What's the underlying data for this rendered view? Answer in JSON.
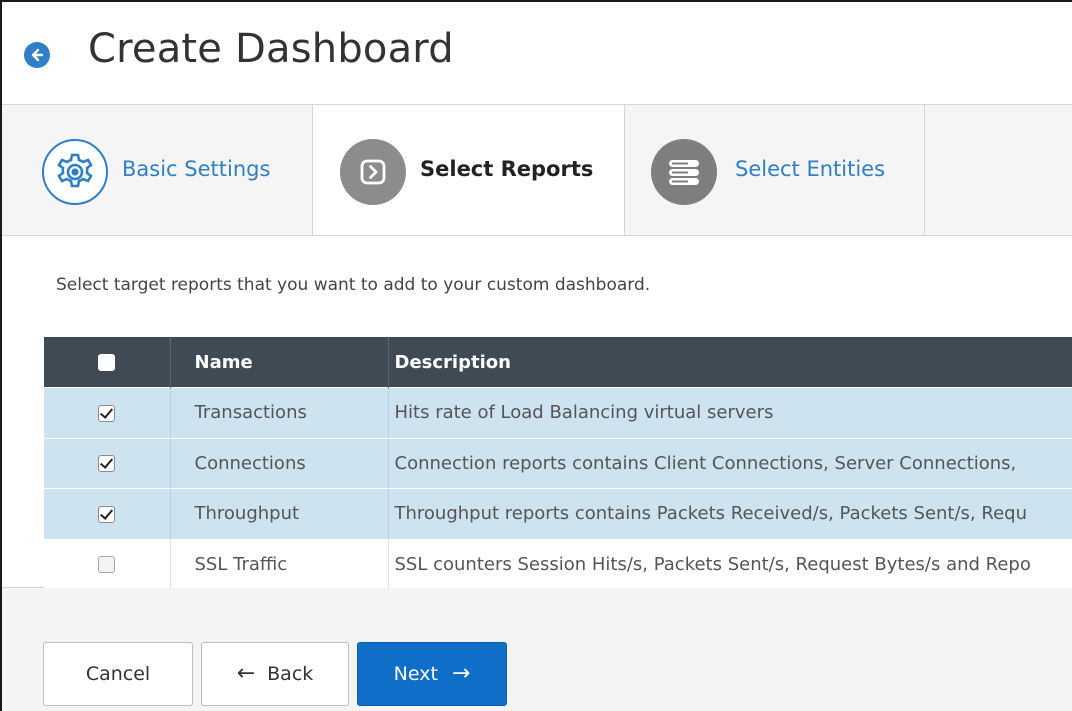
{
  "header": {
    "title": "Create Dashboard",
    "back_icon": "arrow-left-circle-icon"
  },
  "tabs": [
    {
      "label": "Basic Settings",
      "icon": "gear-icon",
      "active": false
    },
    {
      "label": "Select Reports",
      "icon": "chevron-right-box-icon",
      "active": true
    },
    {
      "label": "Select Entities",
      "icon": "server-stack-icon",
      "active": false
    }
  ],
  "instructions": "Select target reports that you want to add to your custom dashboard.",
  "table": {
    "headers": {
      "name": "Name",
      "description": "Description"
    },
    "rows": [
      {
        "checked": true,
        "name": "Transactions",
        "description": "Hits rate of Load Balancing virtual servers"
      },
      {
        "checked": true,
        "name": "Connections",
        "description": "Connection reports contains Client Connections, Server Connections,"
      },
      {
        "checked": true,
        "name": "Throughput",
        "description": "Throughput reports contains Packets Received/s, Packets Sent/s, Requ"
      },
      {
        "checked": false,
        "name": "SSL Traffic",
        "description": "SSL counters Session Hits/s, Packets Sent/s, Request Bytes/s and Repo"
      }
    ]
  },
  "buttons": {
    "cancel": "Cancel",
    "back": "Back",
    "next": "Next"
  },
  "colors": {
    "accent": "#2f7fc6",
    "primary_button": "#0f6ec8",
    "table_header": "#3f4a55",
    "selected_row": "#cde3ef"
  }
}
